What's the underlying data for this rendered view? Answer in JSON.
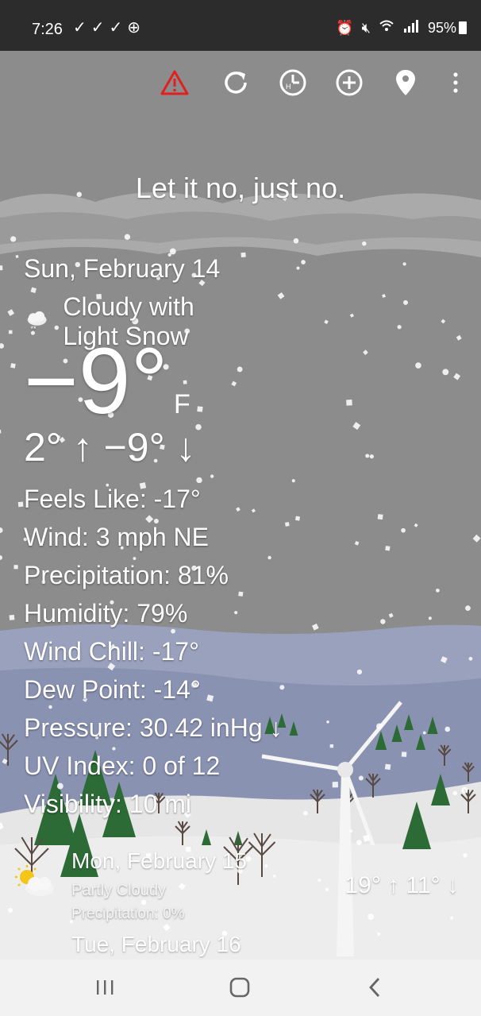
{
  "status": {
    "time": "7:26",
    "left_icons": [
      "check-icon",
      "check-icon",
      "check-icon",
      "basketball-icon"
    ],
    "right_icons": [
      "alarm-icon",
      "mute-icon",
      "wifi-icon",
      "signal-4g-icon"
    ],
    "battery": "95%"
  },
  "toolbar": {
    "icons": [
      "alert-icon",
      "refresh-icon",
      "history-clock-icon",
      "add-location-icon",
      "map-pin-icon",
      "more-vert-icon"
    ],
    "alert_color": "#e02020"
  },
  "tagline": "Let it no, just no.",
  "current": {
    "date": "Sun, February 14",
    "condition": "Cloudy with Light Snow",
    "condition_icon": "cloud-snow-icon",
    "temperature": "−9°",
    "unit": "F",
    "hi_lo": "2° ↑ −9° ↓",
    "details": [
      "Feels Like: -17°",
      "Wind: 3 mph NE",
      "Precipitation: 81%",
      "Humidity: 79%",
      "Wind Chill: -17°",
      "Dew Point: -14°",
      "Pressure: 30.42 inHg ↓",
      "UV Index: 0 of 12",
      "Visibility: 10 mi"
    ]
  },
  "forecast": [
    {
      "day": "Mon, February 15",
      "condition": "Partly Cloudy",
      "precipitation": "Precipitation: 0%",
      "hi_lo": "19° ↑ 11° ↓",
      "icon": "sun-cloud-icon"
    },
    {
      "day": "Tue, February 16"
    }
  ],
  "navbar": {
    "icons": [
      "recent-apps-icon",
      "home-icon",
      "back-icon"
    ]
  },
  "colors": {
    "sky": "#8c8c8c",
    "cloud": "#b0b0b0",
    "hills": "#8e96b4",
    "snow_ground": "#ececec",
    "tree": "#2d6b36",
    "statusbar": "#2c2c2c",
    "navbar": "#f2f2f2"
  }
}
